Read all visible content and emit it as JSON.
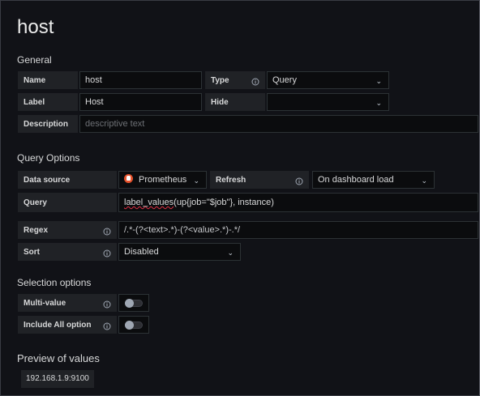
{
  "title": "host",
  "general": {
    "heading": "General",
    "name_label": "Name",
    "name_value": "host",
    "type_label": "Type",
    "type_value": "Query",
    "label_label": "Label",
    "label_value": "Host",
    "hide_label": "Hide",
    "hide_value": "",
    "description_label": "Description",
    "description_placeholder": "descriptive text"
  },
  "query_options": {
    "heading": "Query Options",
    "datasource_label": "Data source",
    "datasource_value": "Prometheus",
    "refresh_label": "Refresh",
    "refresh_value": "On dashboard load",
    "query_label": "Query",
    "query_value_fn": "label_values",
    "query_value_rest": "(up{job=\"$job\"}, instance)",
    "regex_label": "Regex",
    "regex_value": "/.*-(?<text>.*)-(?<value>.*)-.*/",
    "sort_label": "Sort",
    "sort_value": "Disabled"
  },
  "selection": {
    "heading": "Selection options",
    "multi_label": "Multi-value",
    "multi_enabled": false,
    "include_all_label": "Include All option",
    "include_all_enabled": false
  },
  "preview": {
    "heading": "Preview of values",
    "values": [
      "192.168.1.9:9100"
    ]
  },
  "colors": {
    "background": "#111217",
    "prometheus": "#e6522c",
    "spell_error": "#e02f44"
  }
}
